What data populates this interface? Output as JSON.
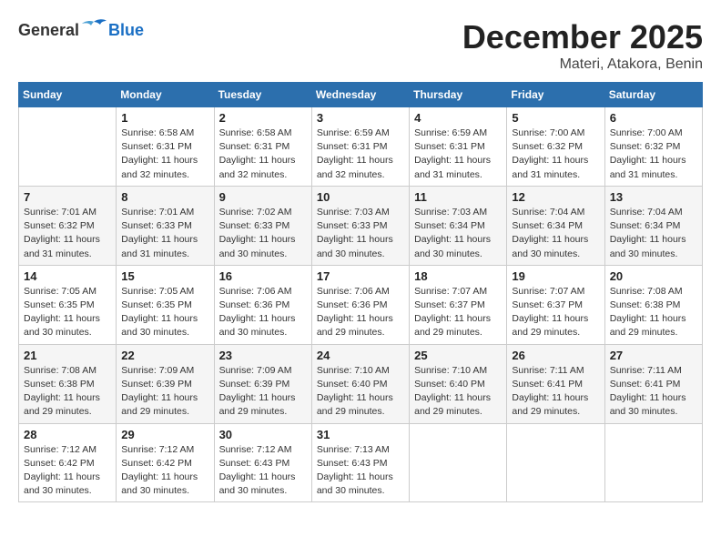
{
  "header": {
    "logo_general": "General",
    "logo_blue": "Blue",
    "month_title": "December 2025",
    "location": "Materi, Atakora, Benin"
  },
  "days_of_week": [
    "Sunday",
    "Monday",
    "Tuesday",
    "Wednesday",
    "Thursday",
    "Friday",
    "Saturday"
  ],
  "weeks": [
    [
      {
        "day": "",
        "sunrise": "",
        "sunset": "",
        "daylight": ""
      },
      {
        "day": "1",
        "sunrise": "Sunrise: 6:58 AM",
        "sunset": "Sunset: 6:31 PM",
        "daylight": "Daylight: 11 hours and 32 minutes."
      },
      {
        "day": "2",
        "sunrise": "Sunrise: 6:58 AM",
        "sunset": "Sunset: 6:31 PM",
        "daylight": "Daylight: 11 hours and 32 minutes."
      },
      {
        "day": "3",
        "sunrise": "Sunrise: 6:59 AM",
        "sunset": "Sunset: 6:31 PM",
        "daylight": "Daylight: 11 hours and 32 minutes."
      },
      {
        "day": "4",
        "sunrise": "Sunrise: 6:59 AM",
        "sunset": "Sunset: 6:31 PM",
        "daylight": "Daylight: 11 hours and 31 minutes."
      },
      {
        "day": "5",
        "sunrise": "Sunrise: 7:00 AM",
        "sunset": "Sunset: 6:32 PM",
        "daylight": "Daylight: 11 hours and 31 minutes."
      },
      {
        "day": "6",
        "sunrise": "Sunrise: 7:00 AM",
        "sunset": "Sunset: 6:32 PM",
        "daylight": "Daylight: 11 hours and 31 minutes."
      }
    ],
    [
      {
        "day": "7",
        "sunrise": "Sunrise: 7:01 AM",
        "sunset": "Sunset: 6:32 PM",
        "daylight": "Daylight: 11 hours and 31 minutes."
      },
      {
        "day": "8",
        "sunrise": "Sunrise: 7:01 AM",
        "sunset": "Sunset: 6:33 PM",
        "daylight": "Daylight: 11 hours and 31 minutes."
      },
      {
        "day": "9",
        "sunrise": "Sunrise: 7:02 AM",
        "sunset": "Sunset: 6:33 PM",
        "daylight": "Daylight: 11 hours and 30 minutes."
      },
      {
        "day": "10",
        "sunrise": "Sunrise: 7:03 AM",
        "sunset": "Sunset: 6:33 PM",
        "daylight": "Daylight: 11 hours and 30 minutes."
      },
      {
        "day": "11",
        "sunrise": "Sunrise: 7:03 AM",
        "sunset": "Sunset: 6:34 PM",
        "daylight": "Daylight: 11 hours and 30 minutes."
      },
      {
        "day": "12",
        "sunrise": "Sunrise: 7:04 AM",
        "sunset": "Sunset: 6:34 PM",
        "daylight": "Daylight: 11 hours and 30 minutes."
      },
      {
        "day": "13",
        "sunrise": "Sunrise: 7:04 AM",
        "sunset": "Sunset: 6:34 PM",
        "daylight": "Daylight: 11 hours and 30 minutes."
      }
    ],
    [
      {
        "day": "14",
        "sunrise": "Sunrise: 7:05 AM",
        "sunset": "Sunset: 6:35 PM",
        "daylight": "Daylight: 11 hours and 30 minutes."
      },
      {
        "day": "15",
        "sunrise": "Sunrise: 7:05 AM",
        "sunset": "Sunset: 6:35 PM",
        "daylight": "Daylight: 11 hours and 30 minutes."
      },
      {
        "day": "16",
        "sunrise": "Sunrise: 7:06 AM",
        "sunset": "Sunset: 6:36 PM",
        "daylight": "Daylight: 11 hours and 30 minutes."
      },
      {
        "day": "17",
        "sunrise": "Sunrise: 7:06 AM",
        "sunset": "Sunset: 6:36 PM",
        "daylight": "Daylight: 11 hours and 29 minutes."
      },
      {
        "day": "18",
        "sunrise": "Sunrise: 7:07 AM",
        "sunset": "Sunset: 6:37 PM",
        "daylight": "Daylight: 11 hours and 29 minutes."
      },
      {
        "day": "19",
        "sunrise": "Sunrise: 7:07 AM",
        "sunset": "Sunset: 6:37 PM",
        "daylight": "Daylight: 11 hours and 29 minutes."
      },
      {
        "day": "20",
        "sunrise": "Sunrise: 7:08 AM",
        "sunset": "Sunset: 6:38 PM",
        "daylight": "Daylight: 11 hours and 29 minutes."
      }
    ],
    [
      {
        "day": "21",
        "sunrise": "Sunrise: 7:08 AM",
        "sunset": "Sunset: 6:38 PM",
        "daylight": "Daylight: 11 hours and 29 minutes."
      },
      {
        "day": "22",
        "sunrise": "Sunrise: 7:09 AM",
        "sunset": "Sunset: 6:39 PM",
        "daylight": "Daylight: 11 hours and 29 minutes."
      },
      {
        "day": "23",
        "sunrise": "Sunrise: 7:09 AM",
        "sunset": "Sunset: 6:39 PM",
        "daylight": "Daylight: 11 hours and 29 minutes."
      },
      {
        "day": "24",
        "sunrise": "Sunrise: 7:10 AM",
        "sunset": "Sunset: 6:40 PM",
        "daylight": "Daylight: 11 hours and 29 minutes."
      },
      {
        "day": "25",
        "sunrise": "Sunrise: 7:10 AM",
        "sunset": "Sunset: 6:40 PM",
        "daylight": "Daylight: 11 hours and 29 minutes."
      },
      {
        "day": "26",
        "sunrise": "Sunrise: 7:11 AM",
        "sunset": "Sunset: 6:41 PM",
        "daylight": "Daylight: 11 hours and 29 minutes."
      },
      {
        "day": "27",
        "sunrise": "Sunrise: 7:11 AM",
        "sunset": "Sunset: 6:41 PM",
        "daylight": "Daylight: 11 hours and 30 minutes."
      }
    ],
    [
      {
        "day": "28",
        "sunrise": "Sunrise: 7:12 AM",
        "sunset": "Sunset: 6:42 PM",
        "daylight": "Daylight: 11 hours and 30 minutes."
      },
      {
        "day": "29",
        "sunrise": "Sunrise: 7:12 AM",
        "sunset": "Sunset: 6:42 PM",
        "daylight": "Daylight: 11 hours and 30 minutes."
      },
      {
        "day": "30",
        "sunrise": "Sunrise: 7:12 AM",
        "sunset": "Sunset: 6:43 PM",
        "daylight": "Daylight: 11 hours and 30 minutes."
      },
      {
        "day": "31",
        "sunrise": "Sunrise: 7:13 AM",
        "sunset": "Sunset: 6:43 PM",
        "daylight": "Daylight: 11 hours and 30 minutes."
      },
      {
        "day": "",
        "sunrise": "",
        "sunset": "",
        "daylight": ""
      },
      {
        "day": "",
        "sunrise": "",
        "sunset": "",
        "daylight": ""
      },
      {
        "day": "",
        "sunrise": "",
        "sunset": "",
        "daylight": ""
      }
    ]
  ]
}
